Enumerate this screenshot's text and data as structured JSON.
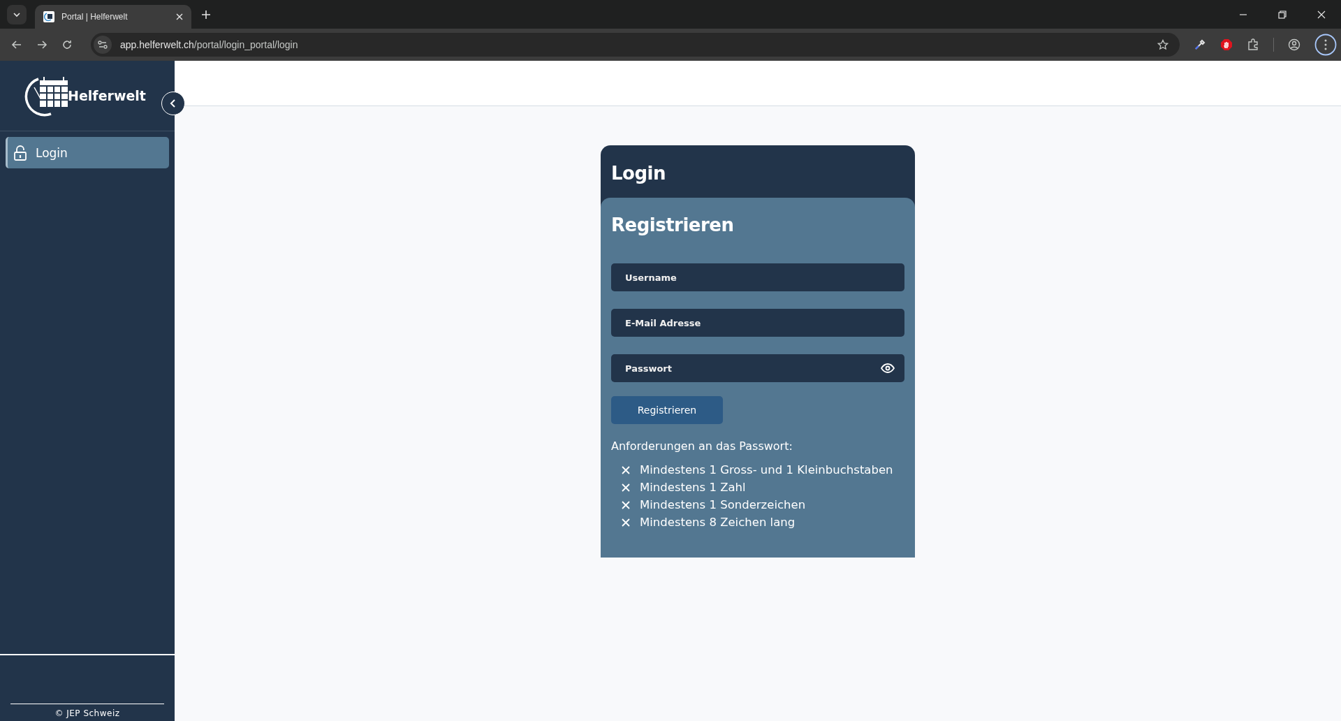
{
  "browser": {
    "tabs": [
      {
        "title": "Portal | Helferwelt",
        "selected": true
      }
    ],
    "url_host": "app.helferwelt.ch",
    "url_path": "/portal/login_portal/login"
  },
  "sidebar": {
    "brand": "Helferwelt",
    "items": [
      {
        "label": "Login",
        "selected": true
      }
    ],
    "footer": "© JEP Schweiz"
  },
  "card": {
    "title": "Login",
    "form_title": "Registrieren",
    "fields": [
      {
        "placeholder": "Username",
        "kind": "text"
      },
      {
        "placeholder": "E-Mail Adresse",
        "kind": "email"
      },
      {
        "placeholder": "Passwort",
        "kind": "password"
      }
    ],
    "submit": "Registrieren",
    "requirements_title": "Anforderungen an das Passwort:",
    "requirements": [
      {
        "text": "Mindestens 1 Gross- und 1 Kleinbuchstaben",
        "met": false
      },
      {
        "text": "Mindestens 1 Zahl",
        "met": false
      },
      {
        "text": "Mindestens 1 Sonderzeichen",
        "met": false
      },
      {
        "text": "Mindestens 8 Zeichen lang",
        "met": false
      }
    ]
  }
}
